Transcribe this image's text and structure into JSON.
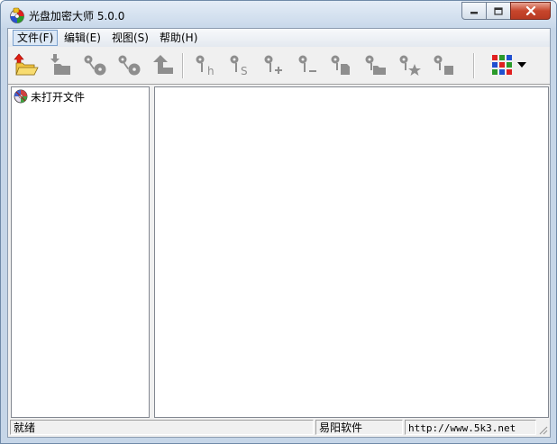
{
  "window": {
    "title": "光盘加密大师 5.0.0",
    "icon": "cd-app-icon",
    "caption_buttons": [
      "minimize-icon",
      "maximize-icon",
      "close-icon"
    ]
  },
  "menu": {
    "items": [
      "文件(F)",
      "编辑(E)",
      "视图(S)",
      "帮助(H)"
    ]
  },
  "toolbar": {
    "buttons": [
      {
        "icon": "open-folder-icon",
        "enabled": true
      },
      {
        "icon": "import-icon",
        "enabled": false
      },
      {
        "icon": "key-disc-icon",
        "enabled": false
      },
      {
        "icon": "key-disc-2-icon",
        "enabled": false
      },
      {
        "icon": "upload-icon",
        "enabled": false
      },
      {
        "icon": "key-hide-icon",
        "enabled": false,
        "glyph": "h"
      },
      {
        "icon": "key-size-icon",
        "enabled": false,
        "glyph": "S"
      },
      {
        "icon": "key-add-icon",
        "enabled": false,
        "glyph": "+"
      },
      {
        "icon": "key-remove-icon",
        "enabled": false,
        "glyph": "−"
      },
      {
        "icon": "key-file-icon",
        "enabled": false
      },
      {
        "icon": "key-folder-icon",
        "enabled": false
      },
      {
        "icon": "key-star-icon",
        "enabled": false
      },
      {
        "icon": "key-stop-icon",
        "enabled": false
      },
      {
        "icon": "color-grid-icon",
        "enabled": true
      },
      {
        "icon": "dropdown-arrow-icon",
        "enabled": true
      }
    ]
  },
  "tree": {
    "root_label": "未打开文件",
    "root_icon": "cd-disc-icon"
  },
  "status": {
    "ready": "就绪",
    "company": "易阳软件",
    "url": "http://www.5k3.net"
  },
  "colors": {
    "title_gradient_top": "#e4ecf6",
    "title_gradient_bottom": "#c8d8ea",
    "close_red": "#c7462c",
    "disabled_gray": "#8e8e8e"
  }
}
